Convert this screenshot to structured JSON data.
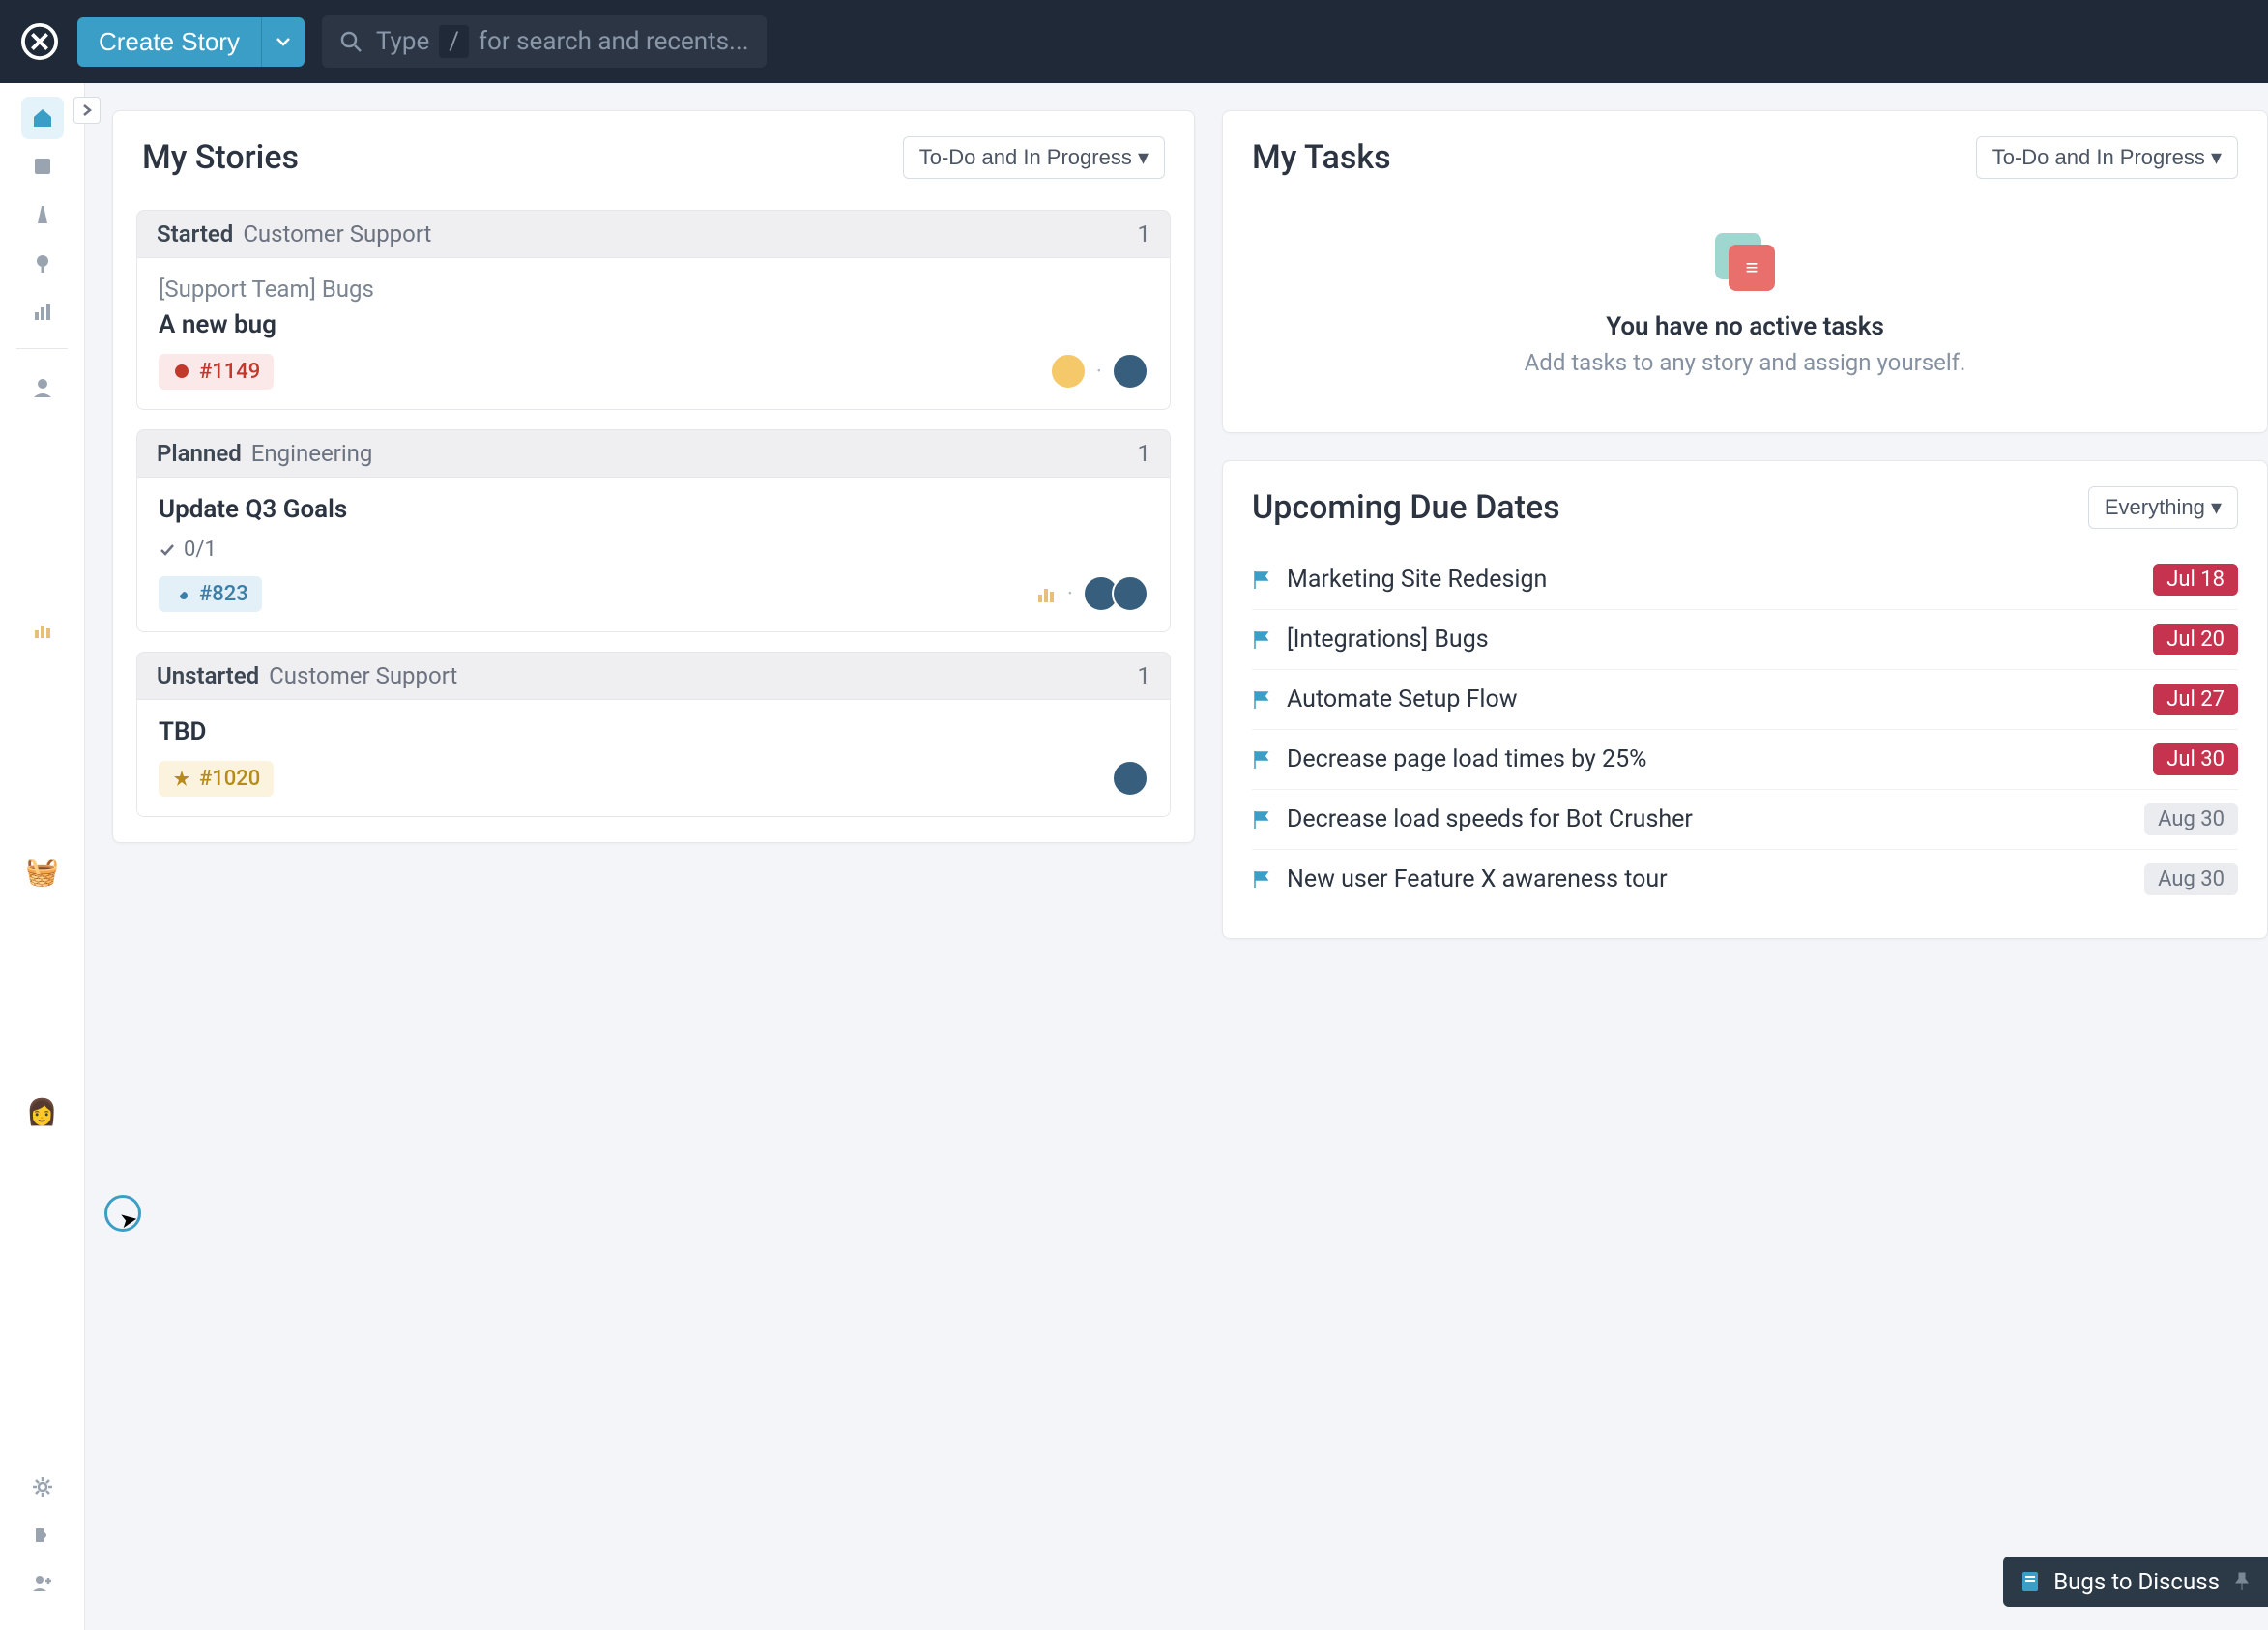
{
  "topbar": {
    "create_label": "Create Story",
    "search_prefix": "Type",
    "search_key": "/",
    "search_placeholder": "for search and recents..."
  },
  "my_stories": {
    "title": "My Stories",
    "filter": "To-Do and In Progress",
    "groups": [
      {
        "status": "Started",
        "workspace": "Customer Support",
        "count": "1",
        "cards": [
          {
            "subtitle": "[Support Team] Bugs",
            "title": "A new bug",
            "tag_type": "bug",
            "tag_id": "#1149",
            "subtasks": null,
            "has_chart": false,
            "avatars": [
              "light",
              "dark"
            ]
          }
        ]
      },
      {
        "status": "Planned",
        "workspace": "Engineering",
        "count": "1",
        "cards": [
          {
            "subtitle": null,
            "title": "Update Q3 Goals",
            "tag_type": "chore",
            "tag_id": "#823",
            "subtasks": "0/1",
            "has_chart": true,
            "avatars": [
              "dark",
              "dark"
            ]
          }
        ]
      },
      {
        "status": "Unstarted",
        "workspace": "Customer Support",
        "count": "1",
        "cards": [
          {
            "subtitle": null,
            "title": "TBD",
            "tag_type": "feature",
            "tag_id": "#1020",
            "subtasks": null,
            "has_chart": false,
            "avatars": [
              "dark"
            ]
          }
        ]
      }
    ]
  },
  "my_tasks": {
    "title": "My Tasks",
    "filter": "To-Do and In Progress",
    "empty_title": "You have no active tasks",
    "empty_sub": "Add tasks to any story and assign yourself."
  },
  "due_dates": {
    "title": "Upcoming Due Dates",
    "filter": "Everything",
    "items": [
      {
        "name": "Marketing Site Redesign",
        "date": "Jul 18",
        "overdue": true
      },
      {
        "name": "[Integrations] Bugs",
        "date": "Jul 20",
        "overdue": true
      },
      {
        "name": "Automate Setup Flow",
        "date": "Jul 27",
        "overdue": true
      },
      {
        "name": "Decrease page load times by 25%",
        "date": "Jul 30",
        "overdue": true
      },
      {
        "name": "Decrease load speeds for Bot Crusher",
        "date": "Aug 30",
        "overdue": false
      },
      {
        "name": "New user Feature X awareness tour",
        "date": "Aug 30",
        "overdue": false
      }
    ]
  },
  "float_pin": {
    "label": "Bugs to Discuss"
  },
  "colors": {
    "primary": "#3b9ec6",
    "topbar_bg": "#1f2937",
    "overdue": "#c5334f"
  }
}
